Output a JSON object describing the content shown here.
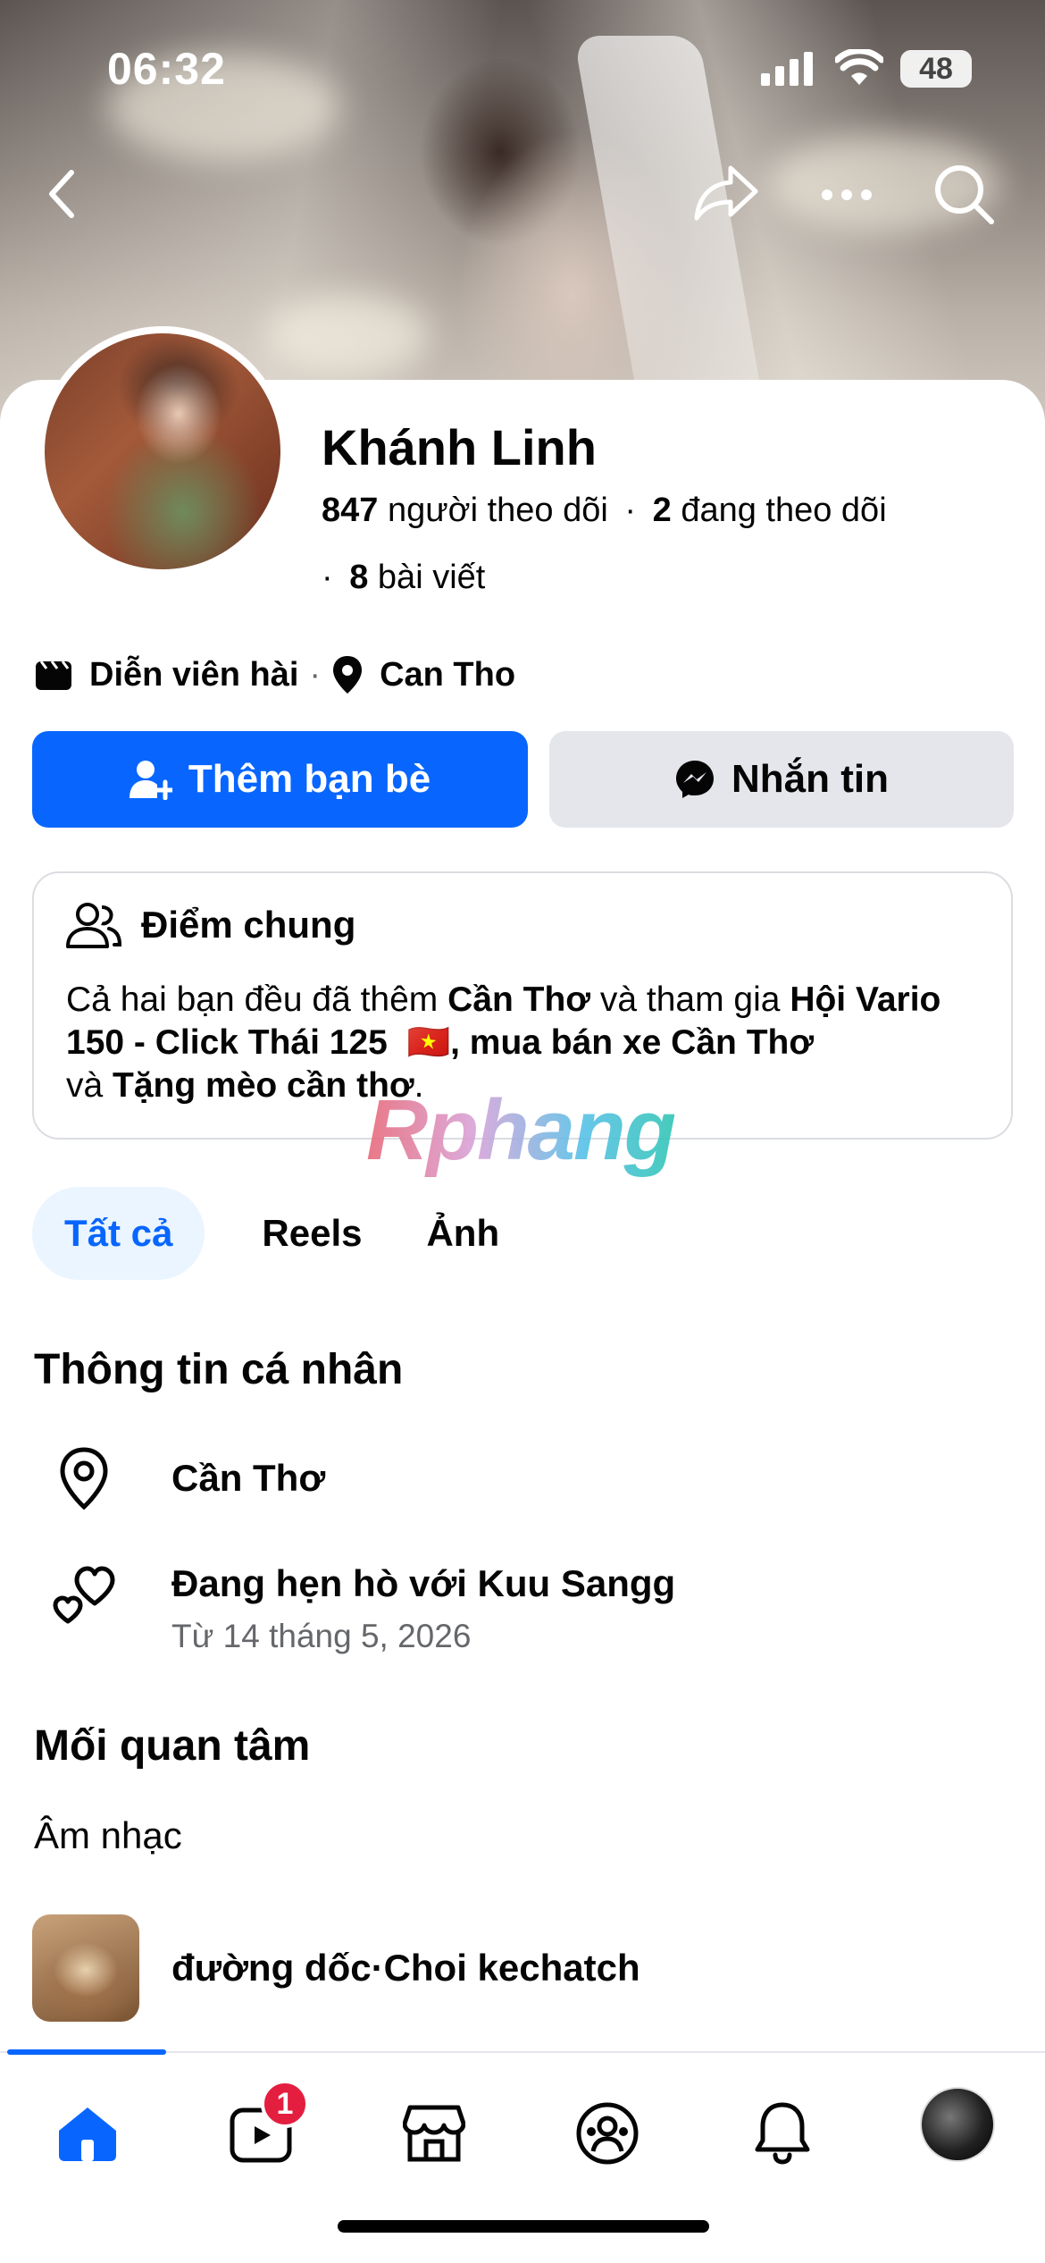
{
  "status_bar": {
    "time": "06:32",
    "battery": "48"
  },
  "profile": {
    "name": "Khánh Linh",
    "followers_count": "847",
    "followers_label": "người theo dõi",
    "following_count": "2",
    "following_label": "đang theo dõi",
    "posts_count": "8",
    "posts_label": "bài viết",
    "job": "Diễn viên hài",
    "location": "Can Tho"
  },
  "actions": {
    "add_friend": "Thêm bạn bè",
    "message": "Nhắn tin"
  },
  "mutual": {
    "title": "Điểm chung",
    "t1": "Cả hai bạn đều đã thêm ",
    "b1": "Cần Thơ",
    "t2": " và tham gia ",
    "b2": "Hội Vario 150 - Click Thái 125",
    "flag": "🇻🇳",
    "b3": ", mua bán xe Cần Thơ",
    "t3": " và ",
    "b4": "Tặng mèo cần thơ",
    "t4": "."
  },
  "watermark": "Rphang",
  "tabs": [
    "Tất cả",
    "Reels",
    "Ảnh"
  ],
  "personal_info": {
    "title": "Thông tin cá nhân",
    "city": "Cần Thơ",
    "relationship": "Đang hẹn hò với Kuu Sangg",
    "relationship_since": "Từ 14 tháng 5, 2026"
  },
  "interests": {
    "title": "Mối quan tâm",
    "category": "Âm nhạc",
    "item": "đường dốc·Choi kechatch"
  },
  "bottom_nav": {
    "video_badge": "1"
  }
}
